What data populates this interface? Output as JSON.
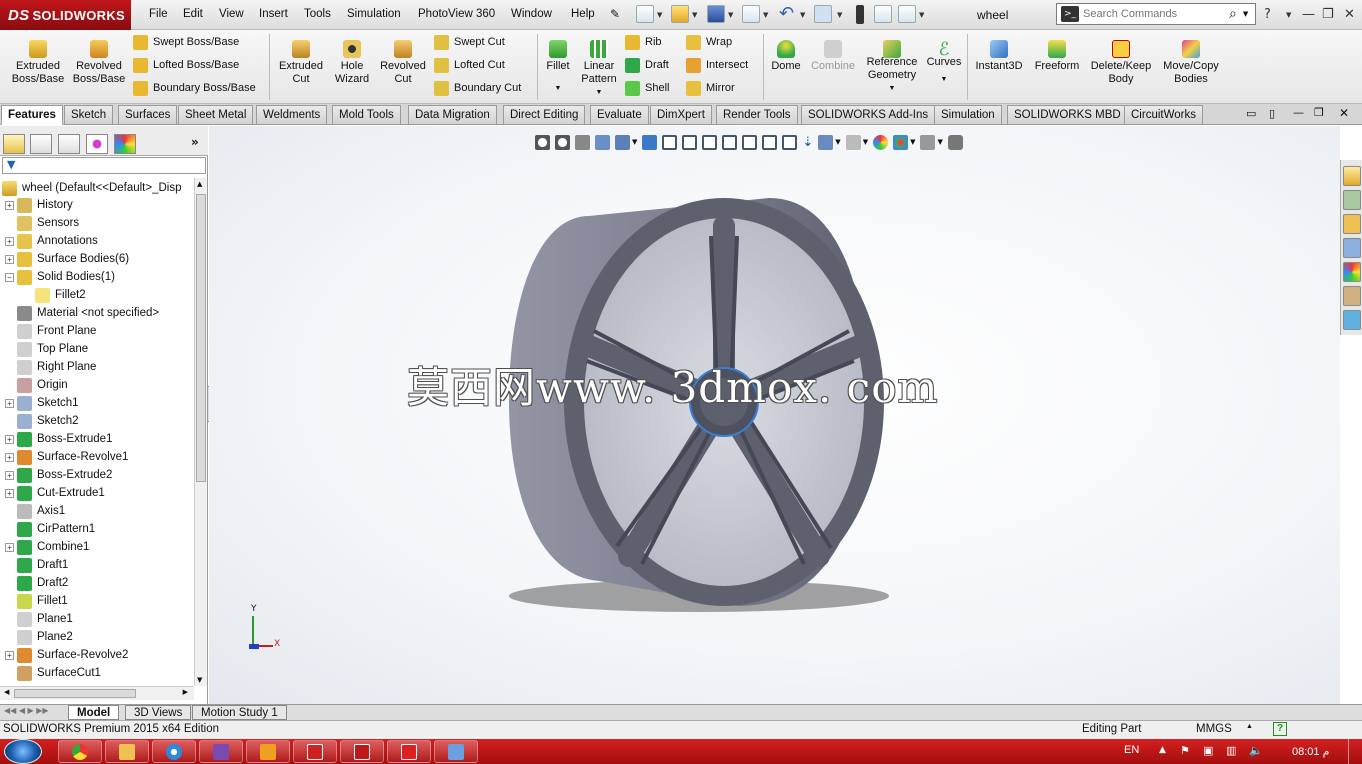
{
  "app": {
    "brand": "SOLIDWORKS",
    "brand_mark": "DS",
    "document_title": "wheel"
  },
  "menu": [
    "File",
    "Edit",
    "View",
    "Insert",
    "Tools",
    "Simulation",
    "PhotoView 360",
    "Window",
    "Help"
  ],
  "search": {
    "placeholder": "Search Commands"
  },
  "features_toolbar": {
    "extruded_boss": "Extruded\nBoss/Base",
    "revolved_boss": "Revolved\nBoss/Base",
    "swept_boss": "Swept Boss/Base",
    "lofted_boss": "Lofted Boss/Base",
    "boundary_boss": "Boundary Boss/Base",
    "extruded_cut": "Extruded\nCut",
    "hole_wizard": "Hole\nWizard",
    "revolved_cut": "Revolved\nCut",
    "swept_cut": "Swept Cut",
    "lofted_cut": "Lofted Cut",
    "boundary_cut": "Boundary Cut",
    "fillet": "Fillet",
    "linear_pattern": "Linear\nPattern",
    "rib": "Rib",
    "draft": "Draft",
    "shell": "Shell",
    "wrap": "Wrap",
    "intersect": "Intersect",
    "mirror": "Mirror",
    "dome": "Dome",
    "combine": "Combine",
    "reference_geometry": "Reference\nGeometry",
    "curves": "Curves",
    "instant3d": "Instant3D",
    "freeform": "Freeform",
    "delete_keep_body": "Delete/Keep\nBody",
    "move_copy_bodies": "Move/Copy\nBodies"
  },
  "tabs": [
    "Features",
    "Sketch",
    "Surfaces",
    "Sheet Metal",
    "Weldments",
    "Mold Tools",
    "Data Migration",
    "Direct Editing",
    "Evaluate",
    "DimXpert",
    "Render Tools",
    "SOLIDWORKS Add-Ins",
    "Simulation",
    "SOLIDWORKS MBD",
    "CircuitWorks"
  ],
  "tree": {
    "root": "wheel  (Default<<Default>_Disp",
    "items": [
      {
        "label": "History",
        "exp": true,
        "indent": 0,
        "color": "#d8b85a"
      },
      {
        "label": "Sensors",
        "exp": false,
        "indent": 0,
        "color": "#e0c060"
      },
      {
        "label": "Annotations",
        "exp": true,
        "indent": 0,
        "color": "#e6c34a"
      },
      {
        "label": "Surface Bodies(6)",
        "exp": true,
        "indent": 0,
        "color": "#e8c040"
      },
      {
        "label": "Solid Bodies(1)",
        "exp": "open",
        "indent": 0,
        "color": "#e8c040"
      },
      {
        "label": "Fillet2",
        "exp": false,
        "indent": 1,
        "color": "#f6e47a"
      },
      {
        "label": "Material <not specified>",
        "exp": false,
        "indent": 0,
        "color": "#8a8a8a"
      },
      {
        "label": "Front Plane",
        "exp": false,
        "indent": 0,
        "color": "#cfcfcf"
      },
      {
        "label": "Top Plane",
        "exp": false,
        "indent": 0,
        "color": "#cfcfcf"
      },
      {
        "label": "Right Plane",
        "exp": false,
        "indent": 0,
        "color": "#cfcfcf"
      },
      {
        "label": "Origin",
        "exp": false,
        "indent": 0,
        "color": "#c8a0a0"
      },
      {
        "label": "Sketch1",
        "exp": true,
        "indent": 0,
        "color": "#9ab0d0"
      },
      {
        "label": "Sketch2",
        "exp": false,
        "indent": 0,
        "color": "#9ab0d0"
      },
      {
        "label": "Boss-Extrude1",
        "exp": true,
        "indent": 0,
        "color": "#2fa84a"
      },
      {
        "label": "Surface-Revolve1",
        "exp": true,
        "indent": 0,
        "color": "#e08a30"
      },
      {
        "label": "Boss-Extrude2",
        "exp": true,
        "indent": 0,
        "color": "#2fa84a"
      },
      {
        "label": "Cut-Extrude1",
        "exp": true,
        "indent": 0,
        "color": "#2fa84a"
      },
      {
        "label": "Axis1",
        "exp": false,
        "indent": 0,
        "color": "#bbbbbb"
      },
      {
        "label": "CirPattern1",
        "exp": false,
        "indent": 0,
        "color": "#2fa84a"
      },
      {
        "label": "Combine1",
        "exp": true,
        "indent": 0,
        "color": "#2fa84a"
      },
      {
        "label": "Draft1",
        "exp": false,
        "indent": 0,
        "color": "#2fa84a"
      },
      {
        "label": "Draft2",
        "exp": false,
        "indent": 0,
        "color": "#2fa84a"
      },
      {
        "label": "Fillet1",
        "exp": false,
        "indent": 0,
        "color": "#c8d84a"
      },
      {
        "label": "Plane1",
        "exp": false,
        "indent": 0,
        "color": "#cfcfcf"
      },
      {
        "label": "Plane2",
        "exp": false,
        "indent": 0,
        "color": "#cfcfcf"
      },
      {
        "label": "Surface-Revolve2",
        "exp": true,
        "indent": 0,
        "color": "#e08a30"
      },
      {
        "label": "SurfaceCut1",
        "exp": false,
        "indent": 0,
        "color": "#d0a060"
      }
    ]
  },
  "watermark": "莫西网www. 3dmox. com",
  "triad": {
    "y": "Y",
    "x": "X"
  },
  "bottom_tabs": [
    "Model",
    "3D Views",
    "Motion Study 1"
  ],
  "status": {
    "product": "SOLIDWORKS Premium 2015 x64 Edition",
    "mode": "Editing Part",
    "units": "MMGS",
    "help": "?"
  },
  "taskbar": {
    "lang": "EN",
    "time": "08:01 م"
  },
  "colors": {
    "brand_red": "#b01015",
    "taskbar_red": "#c01818",
    "wheel_gray": "#6e7384"
  }
}
